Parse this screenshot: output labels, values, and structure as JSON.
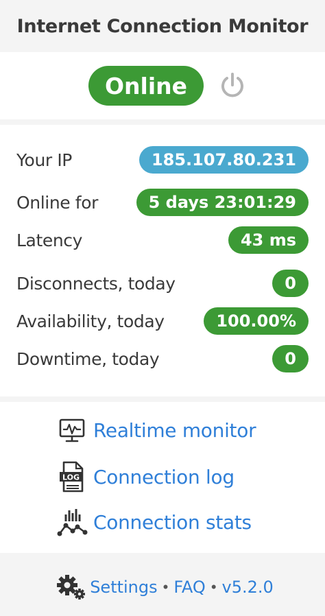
{
  "app": {
    "title": "Internet Connection Monitor"
  },
  "status": {
    "label": "Online",
    "color": "#3c9a35",
    "power_icon": "power-icon"
  },
  "stats": [
    {
      "label": "Your IP",
      "value": "185.107.80.231",
      "color": "#4aa9cf"
    },
    {
      "label": "Online for",
      "value": "5 days 23:01:29",
      "color": "#3c9a35"
    },
    {
      "label": "Latency",
      "value": "43 ms",
      "color": "#3c9a35"
    },
    {
      "label": "Disconnects, today",
      "value": "0",
      "color": "#3c9a35"
    },
    {
      "label": "Availability, today",
      "value": "100.00%",
      "color": "#3c9a35"
    },
    {
      "label": "Downtime, today",
      "value": "0",
      "color": "#3c9a35"
    }
  ],
  "links": [
    {
      "label": "Realtime monitor",
      "icon": "monitor-icon"
    },
    {
      "label": "Connection log",
      "icon": "log-file-icon"
    },
    {
      "label": "Connection stats",
      "icon": "stats-chart-icon"
    }
  ],
  "footer": {
    "settings_label": "Settings",
    "faq_label": "FAQ",
    "version_label": "v5.2.0",
    "separator": "•",
    "icon": "gears-icon"
  },
  "colors": {
    "link": "#2f7fd8",
    "online": "#3c9a35",
    "ip": "#4aa9cf"
  }
}
